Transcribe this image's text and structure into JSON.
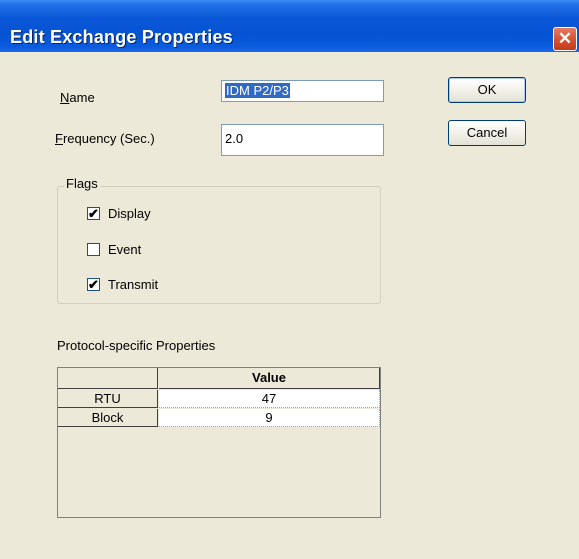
{
  "dialog": {
    "title": "Edit Exchange Properties",
    "close_glyph": "✕"
  },
  "fields": {
    "name": {
      "label_mnemonic": "N",
      "label_rest": "ame",
      "value": "IDM P2/P3"
    },
    "frequency": {
      "label_mnemonic": "F",
      "label_rest": "requency (Sec.)",
      "value": "2.0"
    }
  },
  "buttons": {
    "ok": "OK",
    "cancel": "Cancel"
  },
  "flags": {
    "group_label": "Flags",
    "items": [
      {
        "label": "Display",
        "checked": true,
        "mark": "✔"
      },
      {
        "label": "Event",
        "checked": false,
        "mark": ""
      },
      {
        "label": "Transmit",
        "checked": true,
        "mark": "✔"
      }
    ]
  },
  "protocol": {
    "section_label": "Protocol-specific Properties",
    "column_header": "Value",
    "rows": [
      {
        "name": "RTU",
        "value": "47"
      },
      {
        "name": "Block",
        "value": "9"
      }
    ]
  }
}
